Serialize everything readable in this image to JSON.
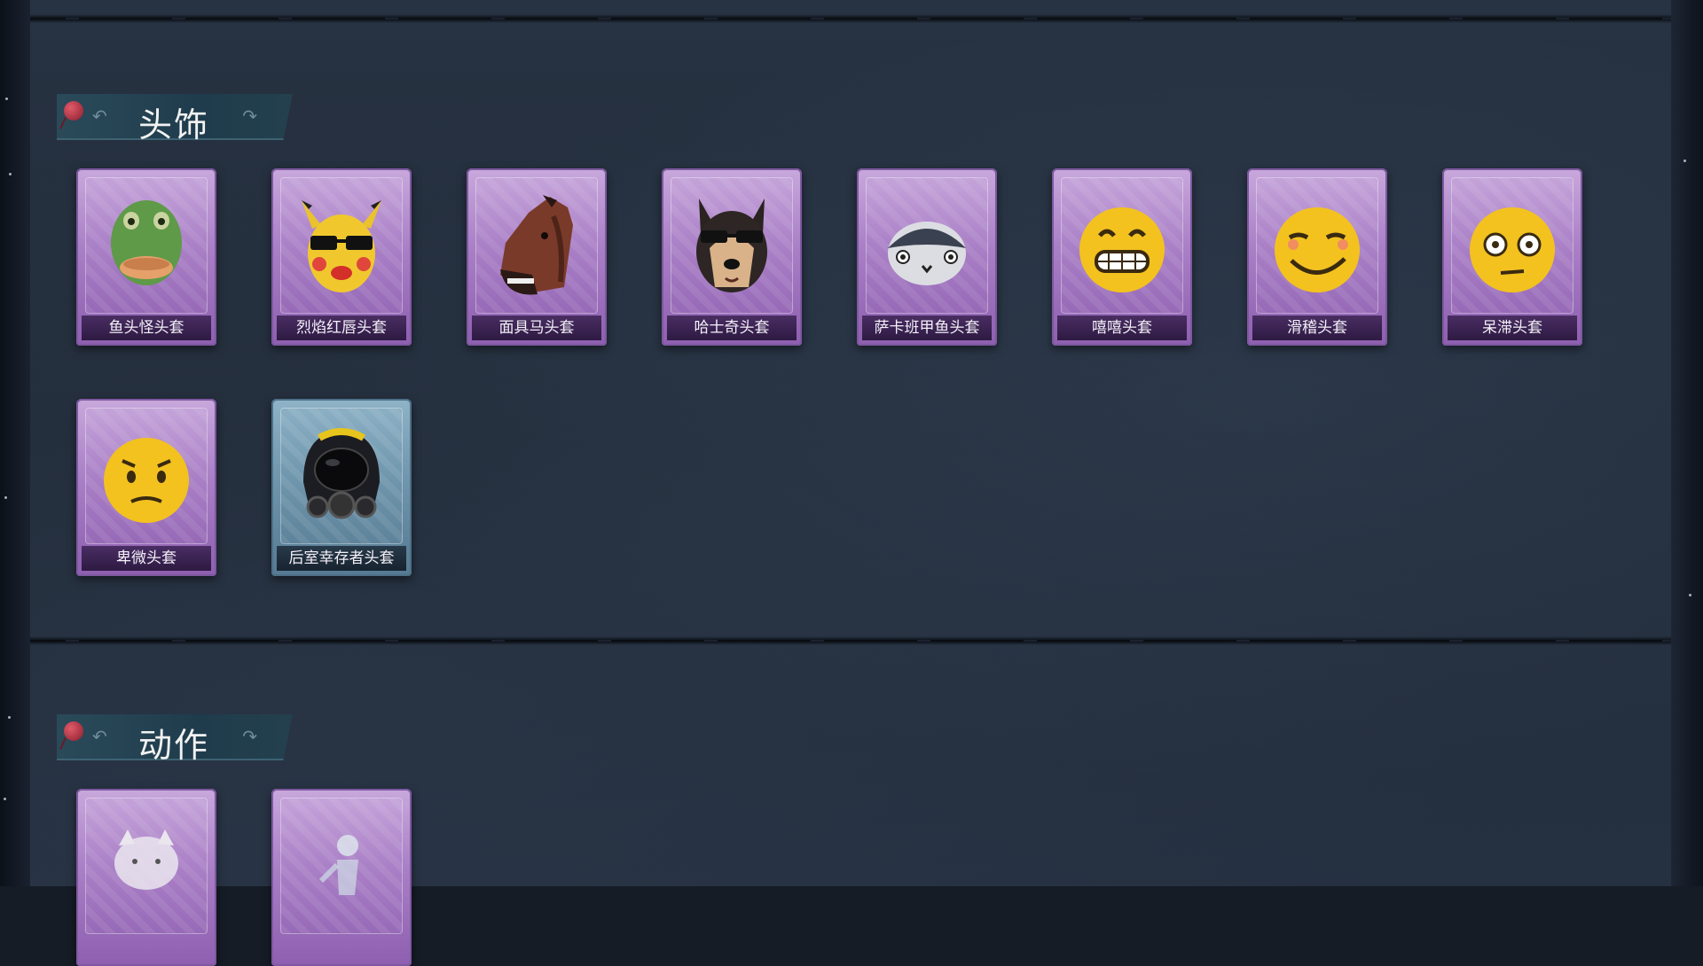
{
  "sections": [
    {
      "title": "头饰",
      "items": [
        {
          "name": "鱼头怪头套",
          "icon": "fish-head-mask-icon",
          "rarity": "purple"
        },
        {
          "name": "烈焰红唇头套",
          "icon": "yellow-creature-sunglasses-mask-icon",
          "rarity": "purple"
        },
        {
          "name": "面具马头套",
          "icon": "horse-head-mask-icon",
          "rarity": "purple"
        },
        {
          "name": "哈士奇头套",
          "icon": "husky-sunglasses-mask-icon",
          "rarity": "purple"
        },
        {
          "name": "萨卡班甲鱼头套",
          "icon": "sacabambaspis-mask-icon",
          "rarity": "purple"
        },
        {
          "name": "嘻嘻头套",
          "icon": "grinning-emoji-mask-icon",
          "rarity": "purple"
        },
        {
          "name": "滑稽头套",
          "icon": "smirk-emoji-mask-icon",
          "rarity": "purple"
        },
        {
          "name": "呆滞头套",
          "icon": "dazed-emoji-mask-icon",
          "rarity": "purple"
        },
        {
          "name": "卑微头套",
          "icon": "pleading-emoji-mask-icon",
          "rarity": "purple"
        },
        {
          "name": "后室幸存者头套",
          "icon": "gas-mask-helmet-icon",
          "rarity": "blue"
        }
      ]
    },
    {
      "title": "动作",
      "items": [
        {
          "name": "",
          "icon": "cat-emote-icon",
          "rarity": "purple"
        },
        {
          "name": "",
          "icon": "figure-emote-icon",
          "rarity": "purple"
        }
      ]
    }
  ],
  "colors": {
    "purple_frame": "#a97fc6",
    "blue_frame": "#6f96ad",
    "panel_bg": "#252f3e",
    "header_bg": "#244252",
    "pin_red": "#c0394a"
  }
}
